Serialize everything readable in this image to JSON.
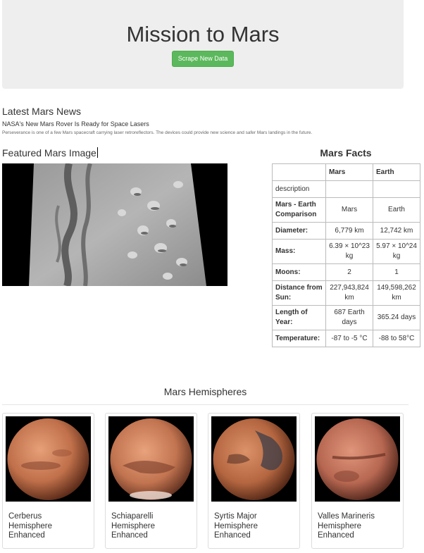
{
  "header": {
    "title": "Mission to Mars",
    "scrape_button": "Scrape New Data"
  },
  "news": {
    "section_title": "Latest Mars News",
    "headline": "NASA's New Mars Rover Is Ready for Space Lasers",
    "teaser": "Perseverance is one of a few Mars spacecraft carrying laser retroreflectors. The devices could provide new science and safer Mars landings in the future."
  },
  "featured": {
    "section_title": "Featured Mars Image"
  },
  "facts": {
    "section_title": "Mars Facts",
    "columns": [
      "",
      "Mars",
      "Earth"
    ],
    "rows": [
      {
        "label": "description",
        "mars": "",
        "earth": ""
      },
      {
        "label": "Mars - Earth Comparison",
        "mars": "Mars",
        "earth": "Earth"
      },
      {
        "label": "Diameter:",
        "mars": "6,779 km",
        "earth": "12,742 km"
      },
      {
        "label": "Mass:",
        "mars": "6.39 × 10^23 kg",
        "earth": "5.97 × 10^24 kg"
      },
      {
        "label": "Moons:",
        "mars": "2",
        "earth": "1"
      },
      {
        "label": "Distance from Sun:",
        "mars": "227,943,824 km",
        "earth": "149,598,262 km"
      },
      {
        "label": "Length of Year:",
        "mars": "687 Earth days",
        "earth": "365.24 days"
      },
      {
        "label": "Temperature:",
        "mars": "-87 to -5 °C",
        "earth": "-88 to 58°C"
      }
    ]
  },
  "hemispheres": {
    "section_title": "Mars Hemispheres",
    "items": [
      {
        "title": "Cerberus Hemisphere Enhanced"
      },
      {
        "title": "Schiaparelli Hemisphere Enhanced"
      },
      {
        "title": "Syrtis Major Hemisphere Enhanced"
      },
      {
        "title": "Valles Marineris Hemisphere Enhanced"
      }
    ]
  }
}
